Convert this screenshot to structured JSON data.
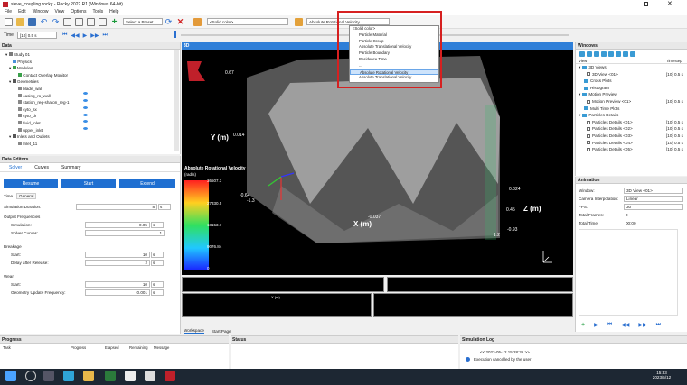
{
  "window": {
    "title": "sieve_coupling.rocky - Rocky 2022 R1 (Windows 64-bit)"
  },
  "menu": [
    "File",
    "Edit",
    "Window",
    "View",
    "Options",
    "Tools",
    "Help"
  ],
  "toolbar": {
    "preset": "Select a Preset",
    "solid_color": "<Solid color>",
    "color_by": "Absolute Rotational Velocity"
  },
  "timebar": {
    "label": "Time",
    "value": "[10] 0.5 s"
  },
  "data_panel": {
    "title": "Data",
    "items": [
      "Study 01",
      "Physics",
      "Modules",
      "Contact Overlap Monitor",
      "Geometries",
      "blade_wall",
      "casing_ro_wall",
      "station_reg-shaton_reg-1",
      "cyto_sx",
      "cyto_dr",
      "fluid_inlet",
      "upper_inlet",
      "Inlets and Outlets",
      "Inlet_11"
    ]
  },
  "data_editors": {
    "title": "Data Editors",
    "tabs": [
      "Solver",
      "Curves",
      "Summary"
    ],
    "buttons": [
      "Resume",
      "Start",
      "Extend"
    ],
    "subtabs": [
      "Time",
      "General"
    ],
    "fields": {
      "simulation_duration": {
        "label": "Simulation Duration:",
        "value": "8",
        "unit": "s"
      },
      "output_title": "Output Frequencies",
      "simulation": {
        "label": "Simulation:",
        "value": "0.05",
        "unit": "s"
      },
      "solver_curves": {
        "label": "Solver Curves:",
        "value": "1",
        "unit": ""
      },
      "breakage_title": "Breakage",
      "start1": {
        "label": "Start:",
        "value": "10",
        "unit": "s"
      },
      "delay": {
        "label": "Delay after Release:",
        "value": "2",
        "unit": "s"
      },
      "wear_title": "Wear",
      "start2": {
        "label": "Start:",
        "value": "10",
        "unit": "s"
      },
      "geom_update": {
        "label": "Geometry Update Frequency:",
        "value": "0.001",
        "unit": "s"
      }
    }
  },
  "viewport": {
    "tab": "3D",
    "legend_title": "Absolute Rotational Velocity",
    "legend_unit": "(rad/s)",
    "legend_values": [
      "36507.3",
      "27330.5",
      "18153.7",
      "9076.84",
      "0"
    ],
    "axis_labels": {
      "y": "Y (m)",
      "x": "X (m)",
      "z": "Z (m)"
    },
    "ticks": {
      "y_top": "0.67",
      "y_mid": "0.014",
      "x_left": "-0.64",
      "x_left2": "-1.3",
      "x_mid": "-0.037",
      "x_right": "1.2",
      "z_a": "0.024",
      "z_b": "0.45",
      "z_c": "-0.93"
    },
    "mini_label": "X (m)"
  },
  "dropdown": {
    "items": [
      "<Solid color>",
      "Particle Material",
      "Particle Group",
      "Absolute Translational Velocity",
      "Particle Boundary",
      "Residence Time",
      "...",
      "Absolute Rotational Velocity",
      "Absolute Translational Velocity"
    ],
    "selected": "Absolute Rotational Velocity"
  },
  "bottom_tabs": [
    "Workspace",
    "Start Page"
  ],
  "windows_panel": {
    "title": "Windows",
    "cols": [
      "View",
      "Timestep"
    ],
    "items": [
      {
        "label": "3D Views",
        "t": ""
      },
      {
        "label": "3D View <01>",
        "t": "[10] 0.5 s"
      },
      {
        "label": "Cross Plots",
        "t": ""
      },
      {
        "label": "Histogram",
        "t": ""
      },
      {
        "label": "Motion Preview",
        "t": ""
      },
      {
        "label": "Motion Preview <01>",
        "t": "[10] 0.5 s"
      },
      {
        "label": "Multi Time Plots",
        "t": ""
      },
      {
        "label": "Particles Details",
        "t": ""
      },
      {
        "label": "Particles Details <01>",
        "t": "[10] 0.5 s"
      },
      {
        "label": "Particles Details <02>",
        "t": "[10] 0.5 s"
      },
      {
        "label": "Particles Details <03>",
        "t": "[10] 0.5 s"
      },
      {
        "label": "Particles Details <04>",
        "t": "[10] 0.5 s"
      },
      {
        "label": "Particles Details <05>",
        "t": "[10] 0.5 s"
      }
    ]
  },
  "animation": {
    "title": "Animation",
    "fields": [
      {
        "label": "Window:",
        "value": "3D View <01>"
      },
      {
        "label": "Camera Interpolation:",
        "value": "Linear"
      },
      {
        "label": "FPS:",
        "value": "30"
      },
      {
        "label": "Total Frames:",
        "value": "0"
      },
      {
        "label": "Total Time:",
        "value": "00:00"
      }
    ]
  },
  "progress": {
    "title": "Progress",
    "cols": [
      "Task",
      "Progress",
      "Elapsed",
      "Remaining",
      "Message"
    ]
  },
  "status": {
    "title": "Status"
  },
  "simlog": {
    "title": "Simulation Log",
    "line1": "<< 2023-05-12 15:28:36 >>",
    "line2": "Execution cancelled by the user"
  },
  "taskbar": {
    "time": "15:33",
    "date": "2023/5/12"
  }
}
